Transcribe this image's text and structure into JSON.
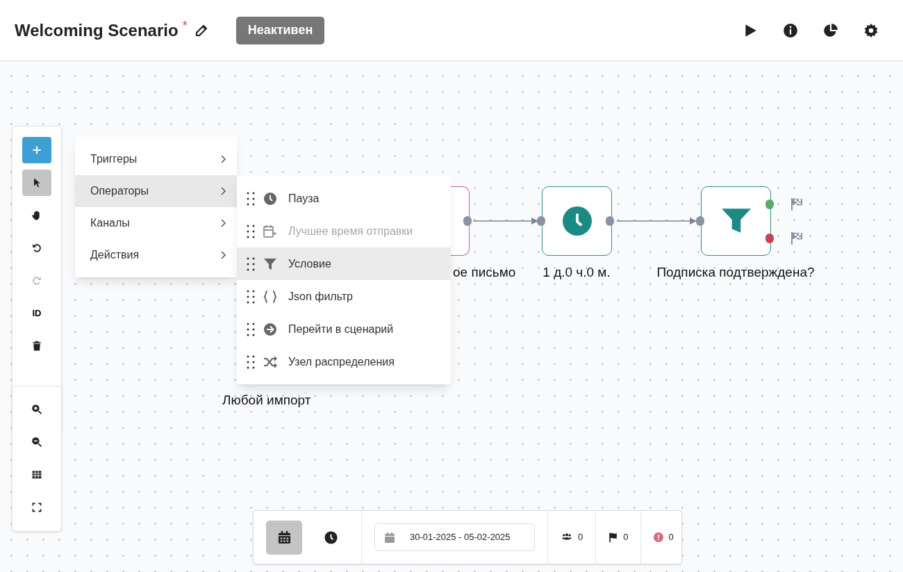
{
  "header": {
    "title": "Welcoming Scenario",
    "unsaved_mark": "*",
    "status": "Неактивен"
  },
  "tools": [
    {
      "kind": "add",
      "selected": false,
      "disabled": false
    },
    {
      "kind": "pointer",
      "selected": true,
      "disabled": false
    },
    {
      "kind": "hand",
      "selected": false,
      "disabled": false
    },
    {
      "kind": "undo",
      "selected": false,
      "disabled": false
    },
    {
      "kind": "redo",
      "selected": false,
      "disabled": true
    },
    {
      "kind": "id",
      "label": "ID",
      "selected": false,
      "disabled": false
    },
    {
      "kind": "delete",
      "selected": false,
      "disabled": false
    }
  ],
  "view_tools": [
    {
      "kind": "zoom-in"
    },
    {
      "kind": "zoom-out"
    },
    {
      "kind": "grid"
    },
    {
      "kind": "fit"
    }
  ],
  "menu": [
    {
      "label": "Триггеры",
      "selected": false
    },
    {
      "label": "Операторы",
      "selected": true
    },
    {
      "label": "Каналы",
      "selected": false
    },
    {
      "label": "Действия",
      "selected": false
    }
  ],
  "submenu": [
    {
      "kind": "clock",
      "label": "Пауза",
      "selected": false,
      "disabled": false
    },
    {
      "kind": "calendar",
      "label": "Лучшее время отправки",
      "selected": false,
      "disabled": true
    },
    {
      "kind": "filter",
      "label": "Условие",
      "selected": true,
      "disabled": false
    },
    {
      "kind": "braces",
      "label": "Json фильтр",
      "selected": false,
      "disabled": false
    },
    {
      "kind": "arrow",
      "label": "Перейти в сценарий",
      "selected": false,
      "disabled": false
    },
    {
      "kind": "shuffle",
      "label": "Узел распределения",
      "selected": false,
      "disabled": false
    }
  ],
  "nodes": [
    {
      "kind": "import",
      "label": "Любой импорт"
    },
    {
      "kind": "email",
      "label": "ое письмо"
    },
    {
      "kind": "pause",
      "label": "1 д.0 ч.0 м."
    },
    {
      "kind": "condition",
      "label": "Подписка подтверждена?"
    }
  ],
  "bottom_bar": {
    "modes": [
      {
        "kind": "calendar",
        "selected": true
      },
      {
        "kind": "clock",
        "selected": false
      }
    ],
    "date_range": "30-01-2025 - 05-02-2025",
    "stats": [
      {
        "kind": "users",
        "value": "0"
      },
      {
        "kind": "flag",
        "value": "0"
      },
      {
        "kind": "error",
        "value": "0"
      }
    ]
  }
}
